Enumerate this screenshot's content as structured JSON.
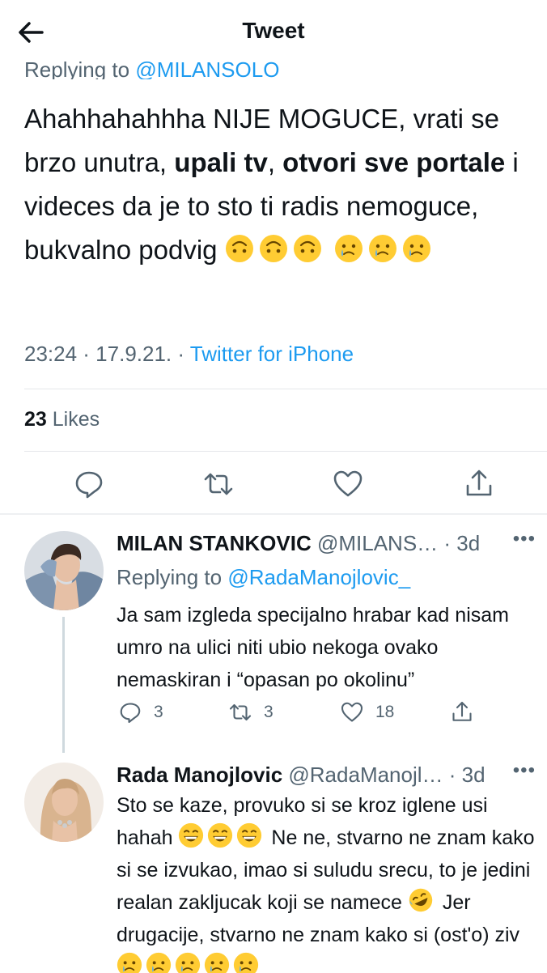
{
  "header": {
    "title": "Tweet"
  },
  "main_tweet": {
    "replying_label": "Replying to ",
    "replying_handle": "@MILANSOLO",
    "text_1": "Ahahhahahhha NIJE MOGUCE, vrati se brzo unutra, ",
    "bold_1": "upali tv",
    "text_2": ", ",
    "bold_2": "otvori sve portale",
    "text_3": " i videces da je to sto ti radis nemoguce, bukvalno podvig ",
    "time": "23:24 · 17.9.21. · ",
    "source": "Twitter for iPhone",
    "likes_count": "23",
    "likes_label": " Likes"
  },
  "replies": [
    {
      "name": "MILAN STANKOVIC",
      "handle": "@MILANS…",
      "time": " · 3d",
      "replying_label": "Replying to ",
      "replying_handle": "@RadaManojlovic_",
      "text": "Ja sam izgleda specijalno hrabar kad nisam umro na ulici niti ubio nekoga ovako nemaskiran i “opasan po okolinu”",
      "reply_count": "3",
      "retweet_count": "3",
      "like_count": "18"
    },
    {
      "name": "Rada Manojlovic",
      "handle": "@RadaManojl…",
      "time": " · 3d",
      "text_1": "Sto se kaze, provuko si se kroz iglene usi hahah ",
      "text_2": " Ne ne, stvarno ne znam kako si se izvukao, imao si suludu srecu, to je jedini realan zakljucak koji se namece ",
      "text_3": " Jer drugacije, stvarno ne znam kako si (ost'o) ziv "
    }
  ],
  "colors": {
    "link": "#1d9bf0",
    "muted": "#536471",
    "text": "#0f1419",
    "emoji": "#ffcc33"
  },
  "icons": [
    "back-arrow-icon",
    "reply-icon",
    "retweet-icon",
    "like-icon",
    "share-icon",
    "more-icon",
    "upside-down-face-emoji",
    "sad-tear-face-emoji",
    "grinning-face-emoji",
    "rofl-face-emoji"
  ]
}
